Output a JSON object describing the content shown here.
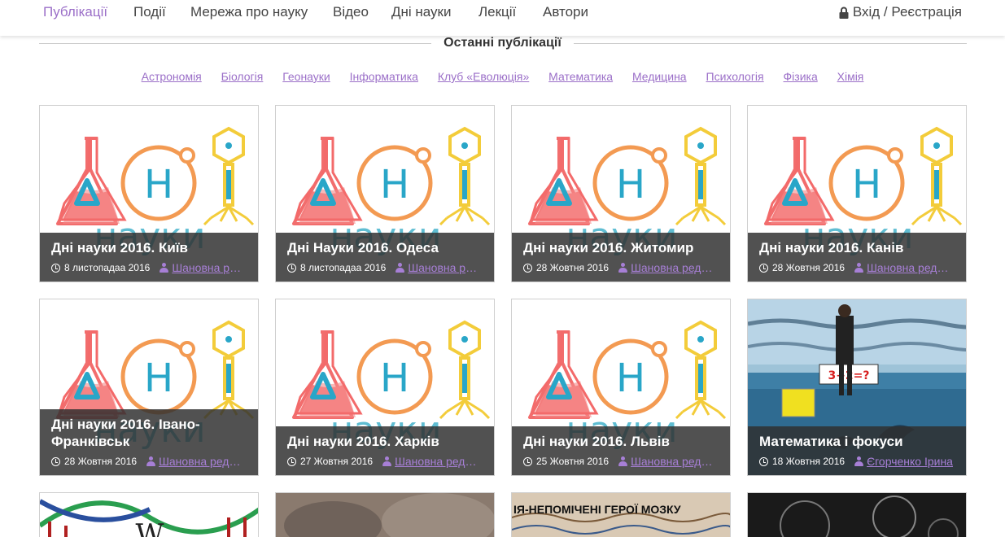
{
  "nav": {
    "items": [
      "Публікації",
      "Події",
      "Мережа про науку",
      "Відео",
      "Дні науки",
      "Лекції",
      "Автори"
    ],
    "active_index": 0,
    "login_label": "Вхід / Реєстрація"
  },
  "section_title": "Останні публікації",
  "categories": [
    "Астрономія",
    "Біологія",
    "Геонауки",
    "Інформатика",
    "Клуб «Еволюція»",
    "Математика",
    "Медицина",
    "Психологія",
    "Фізика",
    "Хімія"
  ],
  "posts": [
    {
      "title": "Дні науки 2016. Київ",
      "date": "8 листопадаа 2016",
      "author": "Шановна редакція",
      "image": "dni-nauky-logo"
    },
    {
      "title": "Дні Науки 2016. Одеса",
      "date": "8 листопадаа 2016",
      "author": "Шановна редакція",
      "image": "dni-nauky-logo"
    },
    {
      "title": "Дні науки 2016. Житомир",
      "date": "28 Жовтня 2016",
      "author": "Шановна редакція",
      "image": "dni-nauky-logo"
    },
    {
      "title": "Дні науки 2016. Канів",
      "date": "28 Жовтня 2016",
      "author": "Шановна редакція",
      "image": "dni-nauky-logo"
    },
    {
      "title": "Дні науки 2016. Івано-Франківськ",
      "date": "28 Жовтня 2016",
      "author": "Шановна редакція",
      "image": "dni-nauky-logo"
    },
    {
      "title": "Дні науки 2016. Харків",
      "date": "27 Жовтня 2016",
      "author": "Шановна редакція",
      "image": "dni-nauky-logo"
    },
    {
      "title": "Дні науки 2016. Львів",
      "date": "25 Жовтня 2016",
      "author": "Шановна редакція",
      "image": "dni-nauky-logo"
    },
    {
      "title": "Математика і фокуси",
      "date": "18 Жовтня 2016",
      "author": "Єгорченко Ірина",
      "image": "dolphin-show-photo",
      "image_text": "3+2=?"
    }
  ],
  "partial_posts": [
    {
      "image": "wikipedia-dna"
    },
    {
      "image": "stone-texture"
    },
    {
      "image": "brain-cells",
      "image_text": "ІЯ-НЕПОМІЧЕНІ ГЕРОЇ МОЗКУ"
    },
    {
      "image": "dark-circles"
    }
  ],
  "colors": {
    "accent": "#9b6fc8",
    "overlay": "#303030"
  }
}
